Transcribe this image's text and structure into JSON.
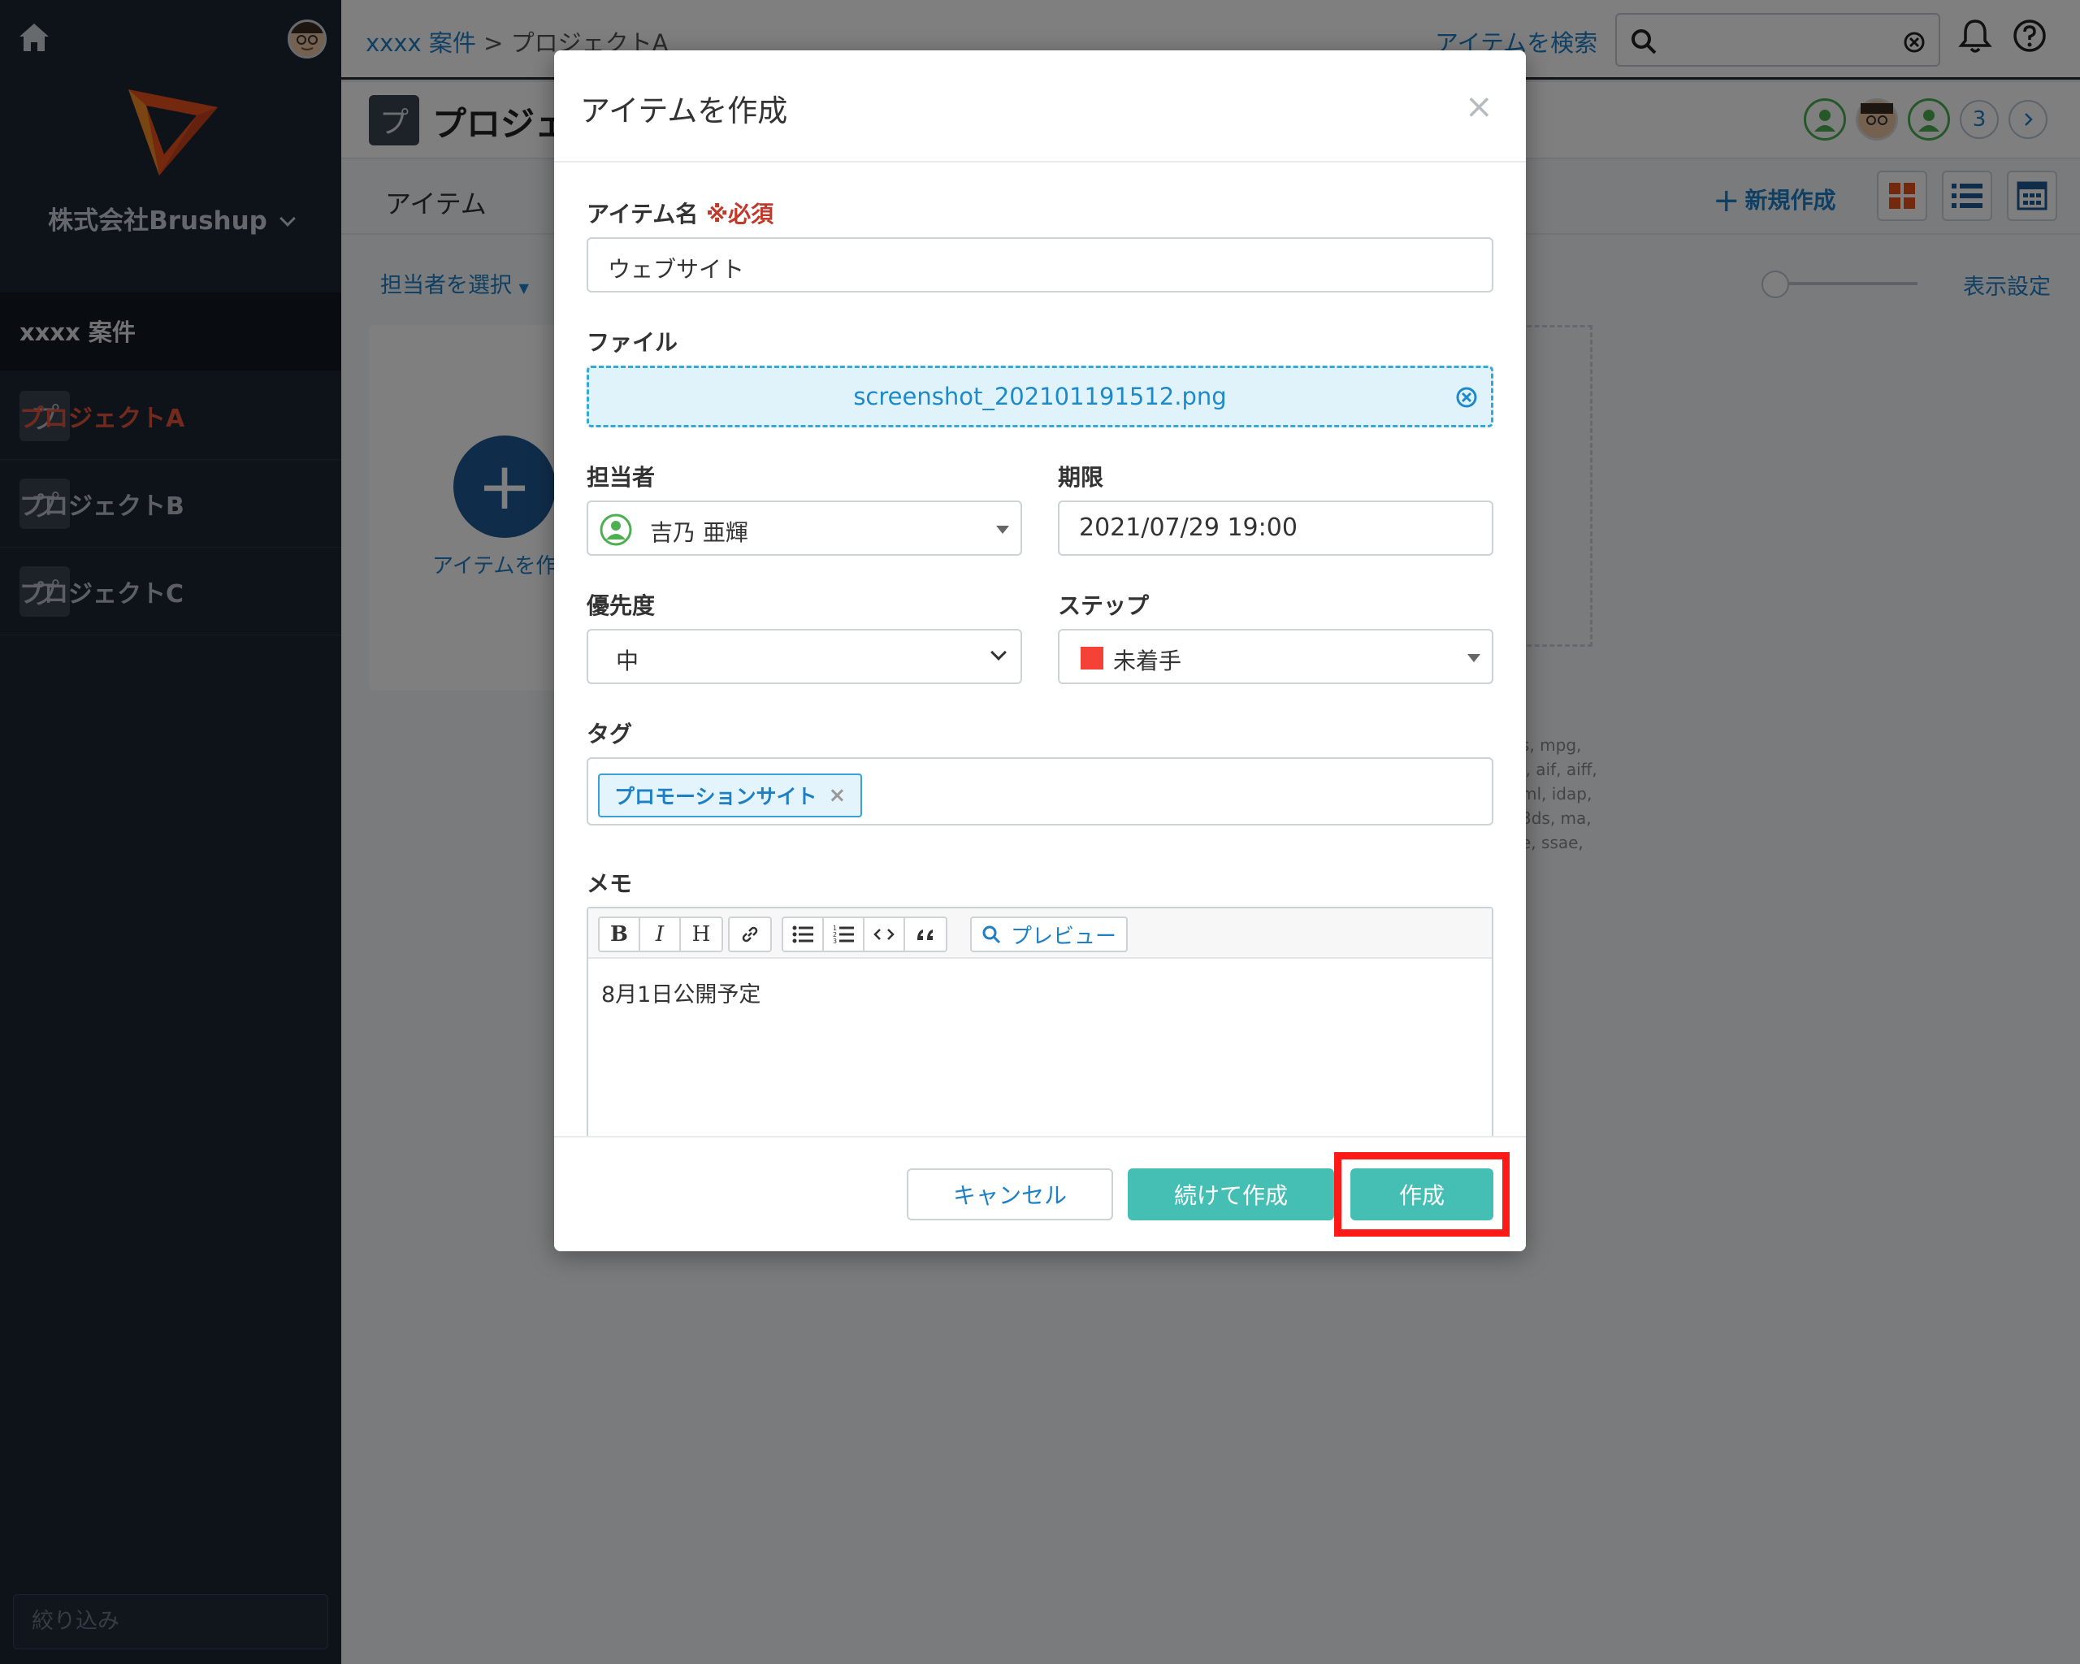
{
  "sidebar": {
    "company": "株式会社Brushup",
    "section_title": "xxxx 案件",
    "projects": [
      {
        "icon_char": "プ",
        "label": "プロジェクトA",
        "active": true
      },
      {
        "icon_char": "プ",
        "label": "プロジェクトB",
        "active": false
      },
      {
        "icon_char": "プ",
        "label": "プロジェクトC",
        "active": false
      }
    ],
    "filter_placeholder": "絞り込み"
  },
  "topbar": {
    "breadcrumb_link": "xxxx 案件",
    "breadcrumb_sep": " > ",
    "breadcrumb_current": "プロジェクトA",
    "search_link": "アイテムを検索"
  },
  "page_header": {
    "icon_char": "プ",
    "title": "プロジェ",
    "member_count": "3"
  },
  "tabs": {
    "items_label": "アイテム",
    "new_label": "新規作成"
  },
  "filters": {
    "assignee_select": "担当者を選択",
    "display_settings": "表示設定"
  },
  "content": {
    "add_plus": "+",
    "add_label": "アイテムを作",
    "ext_lines": [
      "s, mpg,",
      "i, aif, aiff,",
      "ml, idap,",
      "3ds, ma,",
      "e, ssae,"
    ]
  },
  "modal": {
    "title": "アイテムを作成",
    "close": "×",
    "item_name_label": "アイテム名",
    "required_mark": "※必須",
    "item_name_value": "ウェブサイト",
    "file_label": "ファイル",
    "file_name": "screenshot_202101191512.png",
    "assignee_label": "担当者",
    "assignee_value": "吉乃 亜輝",
    "deadline_label": "期限",
    "deadline_value": "2021/07/29 19:00",
    "priority_label": "優先度",
    "priority_value": "中",
    "step_label": "ステップ",
    "step_value": "未着手",
    "step_color": "#f44336",
    "tags_label": "タグ",
    "tag_value": "プロモーションサイト",
    "tag_remove": "×",
    "memo_label": "メモ",
    "toolbar": {
      "bold": "B",
      "italic": "I",
      "heading": "H",
      "preview": "プレビュー"
    },
    "memo_value": "8月1日公開予定",
    "cancel_label": "キャンセル",
    "continue_label": "続けて作成",
    "create_label": "作成"
  },
  "colors": {
    "accent_blue": "#1e7fc4",
    "teal_button": "#45bfb3",
    "highlight_red": "#ff1a1a",
    "sidebar_bg": "#1c2634",
    "active_orange": "#e2553a"
  }
}
